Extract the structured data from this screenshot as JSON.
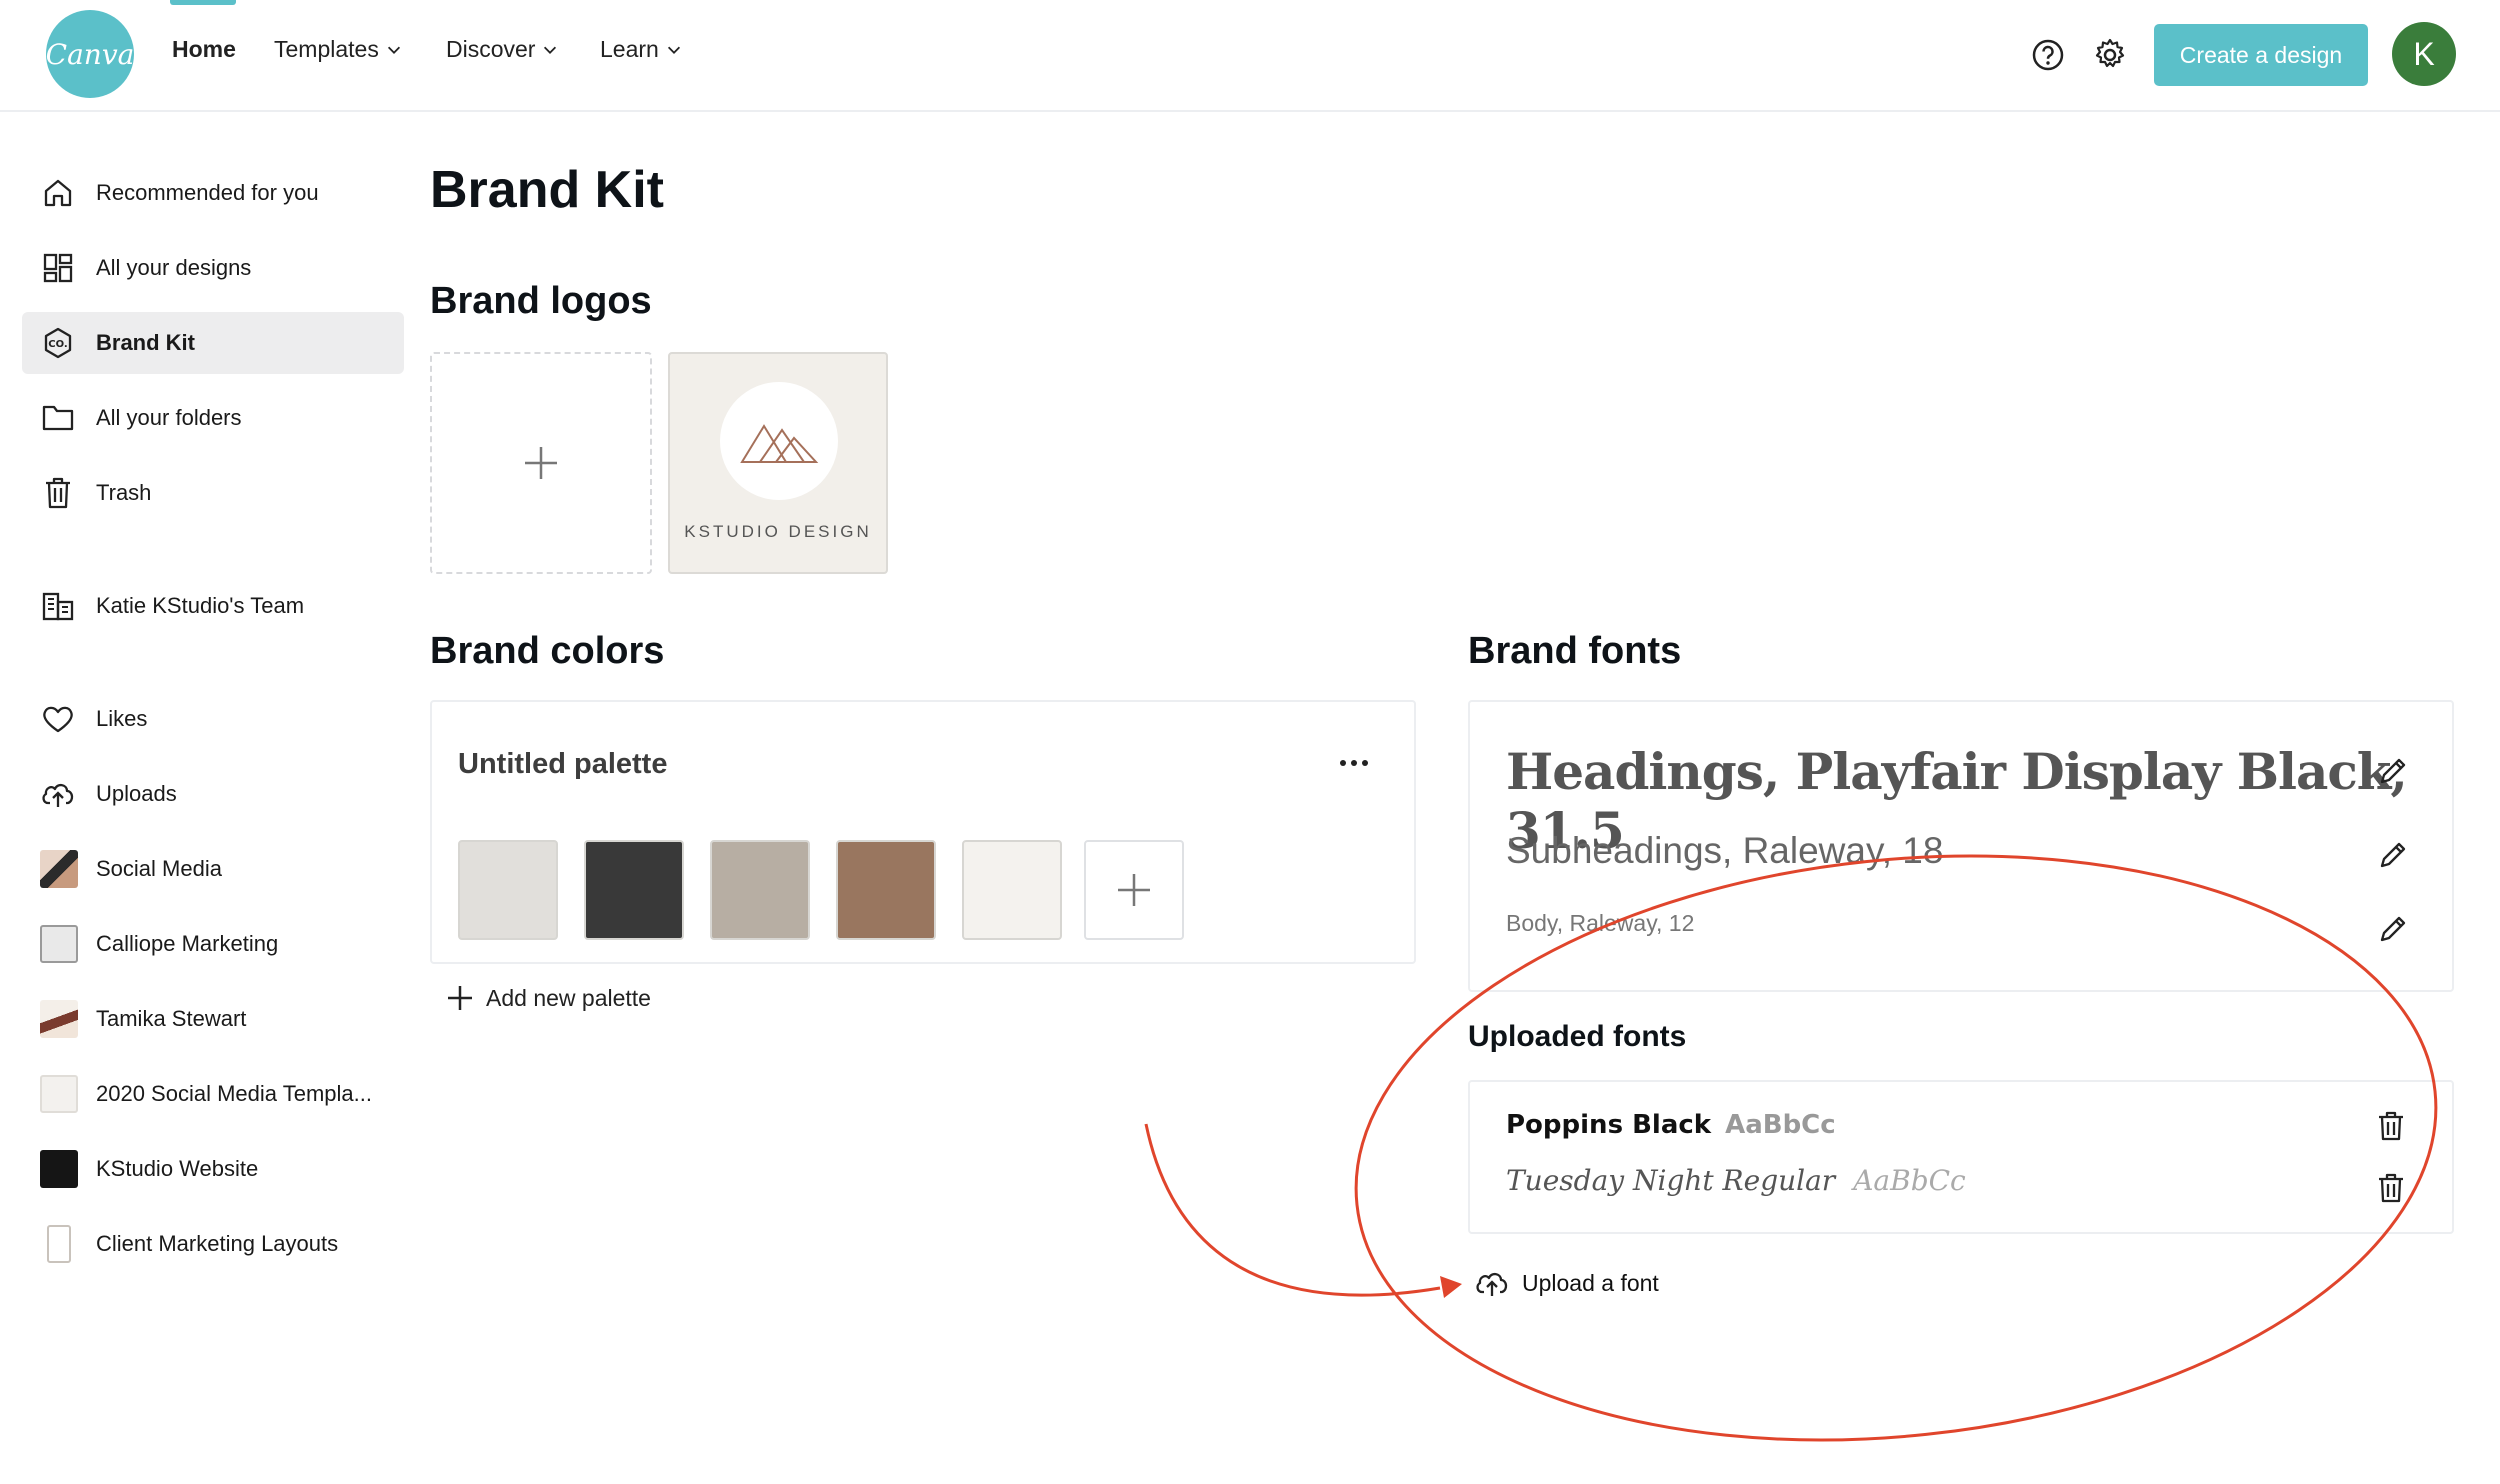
{
  "app": {
    "logo_text": "Canva"
  },
  "nav": {
    "items": [
      {
        "label": "Home"
      },
      {
        "label": "Templates"
      },
      {
        "label": "Discover"
      },
      {
        "label": "Learn"
      }
    ],
    "create_button": "Create a design",
    "avatar_initial": "K"
  },
  "sidebar": {
    "items": [
      {
        "label": "Recommended for you",
        "icon": "home-icon"
      },
      {
        "label": "All your designs",
        "icon": "grid-icon"
      },
      {
        "label": "Brand Kit",
        "icon": "brand-kit-icon",
        "selected": true
      },
      {
        "label": "All your folders",
        "icon": "folder-icon"
      },
      {
        "label": "Trash",
        "icon": "trash-icon"
      },
      {
        "label": "Katie KStudio's Team",
        "icon": "building-icon"
      },
      {
        "label": "Likes",
        "icon": "heart-icon"
      },
      {
        "label": "Uploads",
        "icon": "cloud-upload-icon"
      },
      {
        "label": "Social Media",
        "icon": "folder-thumbnail"
      },
      {
        "label": "Calliope Marketing",
        "icon": "folder-thumbnail"
      },
      {
        "label": "Tamika Stewart",
        "icon": "folder-thumbnail"
      },
      {
        "label": "2020 Social Media Templa...",
        "icon": "folder-thumbnail"
      },
      {
        "label": "KStudio Website",
        "icon": "folder-thumbnail"
      },
      {
        "label": "Client Marketing Layouts",
        "icon": "folder-thumbnail"
      }
    ]
  },
  "main": {
    "title": "Brand Kit",
    "logos": {
      "heading": "Brand logos",
      "items": [
        {
          "caption": "KSTUDIO DESIGN"
        }
      ]
    },
    "colors": {
      "heading": "Brand colors",
      "palette_name": "Untitled palette",
      "swatches": [
        "#e1dfdb",
        "#393939",
        "#b7aea3",
        "#99765f",
        "#f4f2ee"
      ],
      "add_palette": "Add new palette"
    },
    "fonts": {
      "heading": "Brand fonts",
      "heading_font": "Headings, Playfair Display Black, 31.5",
      "subheading_font": "Subheadings, Raleway, 18",
      "body_font": "Body, Raleway, 12",
      "uploaded_title": "Uploaded fonts",
      "uploaded": [
        {
          "name": "Poppins Black",
          "sample": "AaBbCc"
        },
        {
          "name": "Tuesday Night Regular",
          "sample": "AaBbCc"
        }
      ],
      "upload_button": "Upload a font"
    }
  },
  "colors": {
    "accent": "#5bc0c9",
    "avatar": "#3a7d3b",
    "annotation": "#e0452c"
  }
}
